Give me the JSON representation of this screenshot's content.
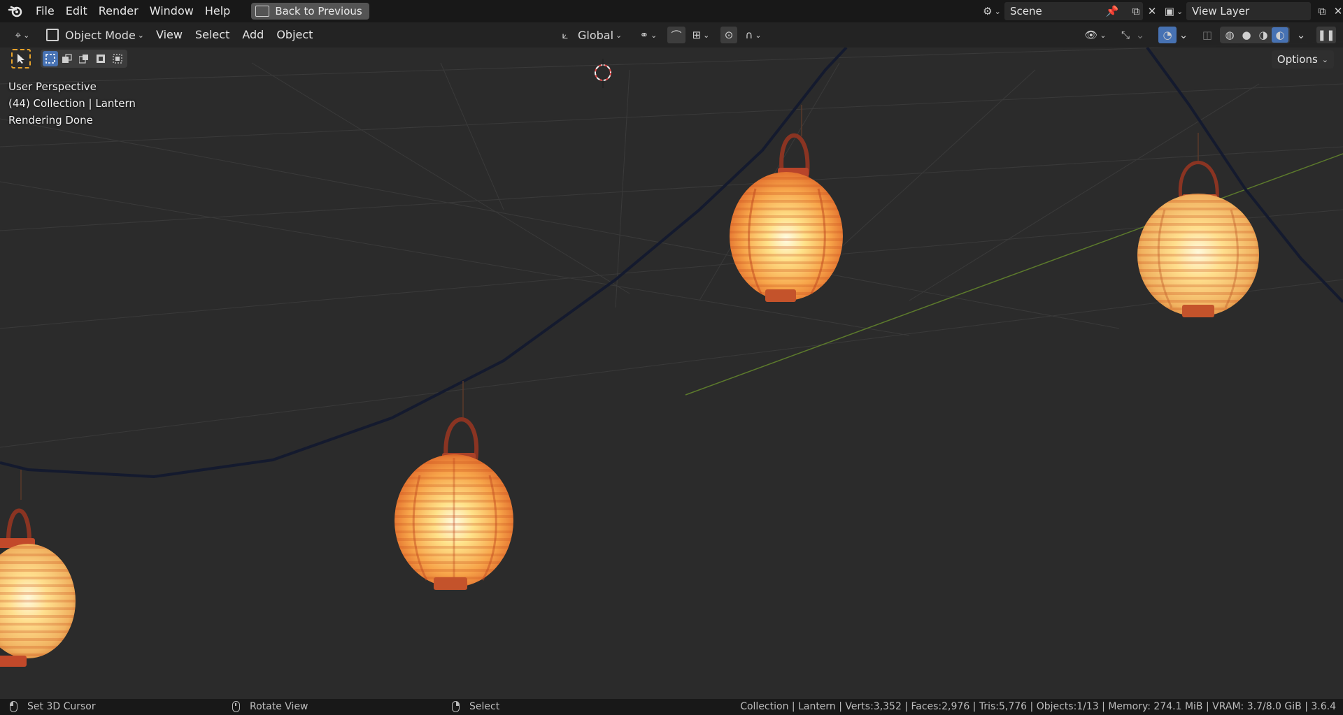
{
  "menubar": {
    "items": [
      "File",
      "Edit",
      "Render",
      "Window",
      "Help"
    ],
    "back_button": "Back to Previous",
    "scene_name": "Scene",
    "view_layer": "View Layer"
  },
  "header": {
    "mode": "Object Mode",
    "menus": [
      "View",
      "Select",
      "Add",
      "Object"
    ],
    "orientation": "Global",
    "options": "Options"
  },
  "viewport": {
    "view_name": "User Perspective",
    "collection_info": "(44) Collection | Lantern",
    "render_status": "Rendering Done"
  },
  "statusbar": {
    "left_action": "Set 3D Cursor",
    "middle_action": "Rotate View",
    "right_action": "Select",
    "stats": "Collection | Lantern | Verts:3,352 | Faces:2,976 | Tris:5,776 | Objects:1/13 | Memory: 274.1 MiB | VRAM: 3.7/8.0 GiB | 3.6.4"
  },
  "colors": {
    "accent_blue": "#4772b3",
    "active_tool_outline": "#e8a32a",
    "lantern_glow": "#ffd98a",
    "lantern_body": "#f08a3c"
  }
}
